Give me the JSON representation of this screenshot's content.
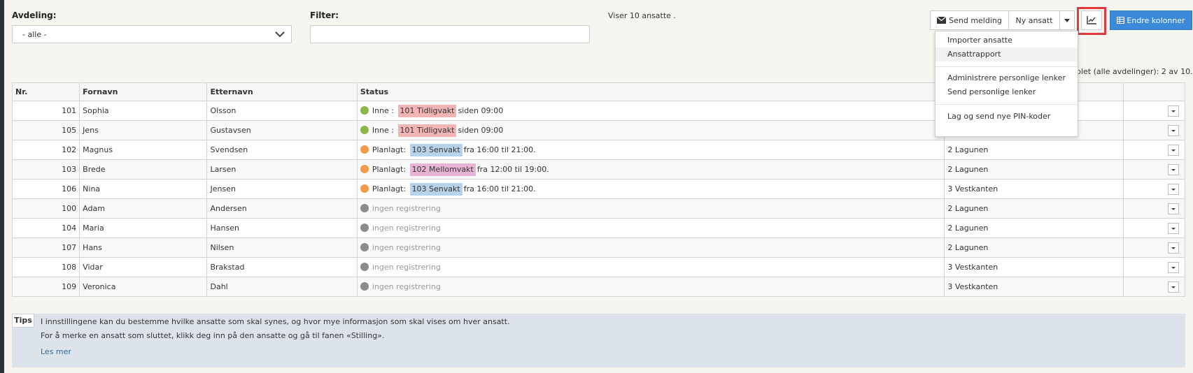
{
  "filters": {
    "department_label": "Avdeling:",
    "department_value": "- alle -",
    "filter_label": "Filter:",
    "filter_value": ""
  },
  "status_text": "Viser 10 ansatte .",
  "toolbar": {
    "send_message": "Send melding",
    "new_employee": "Ny ansatt",
    "change_columns": "Endre kolonner"
  },
  "dropdown_menu": {
    "items": [
      "Importer ansatte",
      "Ansattrapport",
      "Administrere personlige lenker",
      "Send personlige lenker",
      "Lag og send nye PIN-koder"
    ]
  },
  "right_note": "nplet (alle avdelinger): 2 av 10.",
  "table": {
    "headers": {
      "nr": "Nr.",
      "first": "Fornavn",
      "last": "Etternavn",
      "status": "Status"
    },
    "rows": [
      {
        "nr": "101",
        "first": "Sophia",
        "last": "Olsson",
        "state": "Inne :",
        "dot": "#8ab64a",
        "shift": "101 Tidligvakt",
        "shift_color": "#f2b4b4",
        "time": "siden 09:00",
        "dept": ""
      },
      {
        "nr": "105",
        "first": "Jens",
        "last": "Gustavsen",
        "state": "Inne :",
        "dot": "#8ab64a",
        "shift": "101 Tidligvakt",
        "shift_color": "#f2b4b4",
        "time": "siden 09:00",
        "dept": ""
      },
      {
        "nr": "102",
        "first": "Magnus",
        "last": "Svendsen",
        "state": "Planlagt:",
        "dot": "#f5994a",
        "shift": "103 Senvakt",
        "shift_color": "#b7d3ec",
        "time": "fra 16:00 til 21:00.",
        "dept": "2 Lagunen"
      },
      {
        "nr": "103",
        "first": "Brede",
        "last": "Larsen",
        "state": "Planlagt:",
        "dot": "#f5994a",
        "shift": "102 Mellomvakt",
        "shift_color": "#e8b4d6",
        "time": "fra 12:00 til 19:00.",
        "dept": "2 Lagunen"
      },
      {
        "nr": "106",
        "first": "Nina",
        "last": "Jensen",
        "state": "Planlagt:",
        "dot": "#f5994a",
        "shift": "103 Senvakt",
        "shift_color": "#b7d3ec",
        "time": "fra 16:00 til 21:00.",
        "dept": "3 Vestkanten"
      },
      {
        "nr": "100",
        "first": "Adam",
        "last": "Andersen",
        "state": "ingen registrering",
        "dot": "#8c8c8c",
        "shift": "",
        "shift_color": "",
        "time": "",
        "dept": "2 Lagunen"
      },
      {
        "nr": "104",
        "first": "Maria",
        "last": "Hansen",
        "state": "ingen registrering",
        "dot": "#8c8c8c",
        "shift": "",
        "shift_color": "",
        "time": "",
        "dept": "2 Lagunen"
      },
      {
        "nr": "107",
        "first": "Hans",
        "last": "Nilsen",
        "state": "ingen registrering",
        "dot": "#8c8c8c",
        "shift": "",
        "shift_color": "",
        "time": "",
        "dept": "2 Lagunen"
      },
      {
        "nr": "108",
        "first": "Vidar",
        "last": "Brakstad",
        "state": "ingen registrering",
        "dot": "#8c8c8c",
        "shift": "",
        "shift_color": "",
        "time": "",
        "dept": "3 Vestkanten"
      },
      {
        "nr": "109",
        "first": "Veronica",
        "last": "Dahl",
        "state": "ingen registrering",
        "dot": "#8c8c8c",
        "shift": "",
        "shift_color": "",
        "time": "",
        "dept": "3 Vestkanten"
      }
    ]
  },
  "tips": {
    "badge": "Tips",
    "line1": "I innstillingene kan du bestemme hvilke ansatte som skal synes, og hvor mye informasjon som skal vises om hver ansatt.",
    "line2": "For å merke en ansatt som sluttet, klikk deg inn på den ansatte og gå til fanen «Stilling».",
    "link": "Les mer"
  }
}
